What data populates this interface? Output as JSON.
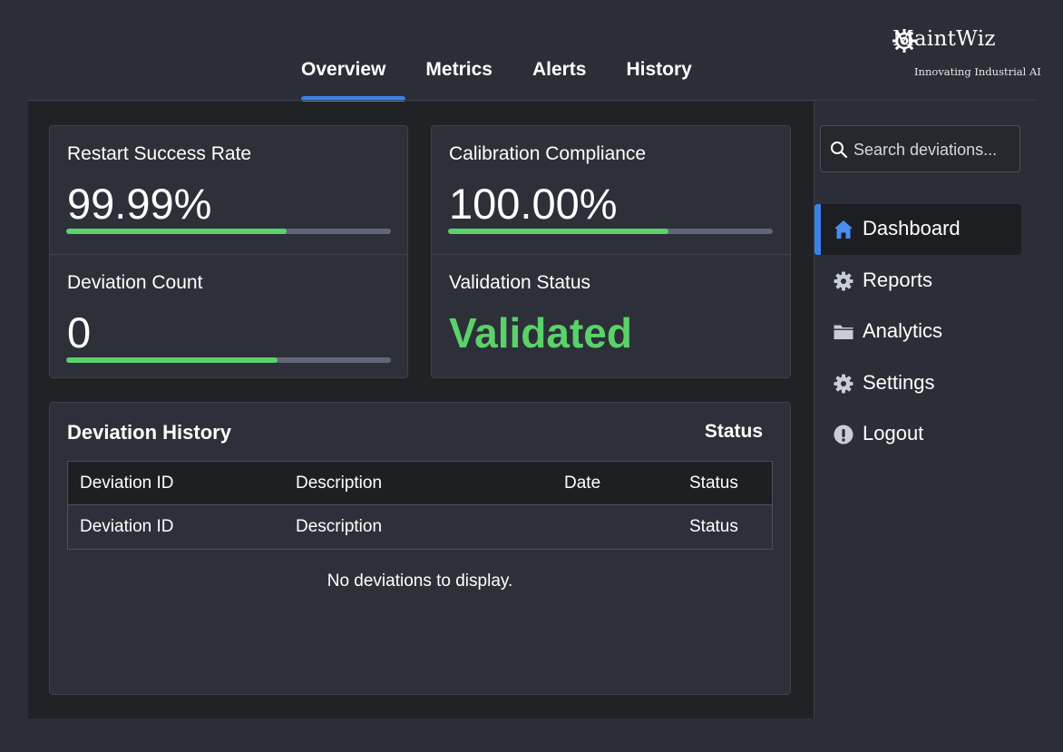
{
  "brand": {
    "name": "MaintWiz",
    "tagline": "Innovating Industrial AI"
  },
  "tabs": [
    {
      "label": "Overview",
      "active": true
    },
    {
      "label": "Metrics",
      "active": false
    },
    {
      "label": "Alerts",
      "active": false
    },
    {
      "label": "History",
      "active": false
    }
  ],
  "metrics": {
    "restart": {
      "label": "Restart Success Rate",
      "value": "99.99%",
      "progress": 0.68
    },
    "calibration": {
      "label": "Calibration Compliance",
      "value": "100.00%",
      "progress": 0.68
    },
    "deviation": {
      "label": "Deviation Count",
      "value": "0",
      "progress": 0.65
    },
    "validation": {
      "label": "Validation Status",
      "value": "Validated"
    }
  },
  "history": {
    "title": "Deviation History",
    "status_label": "Status",
    "columns": [
      "Deviation ID",
      "Description",
      "Date",
      "Status"
    ],
    "rows": [
      [
        "Deviation ID",
        "Description",
        "",
        "Status"
      ]
    ],
    "empty_message": "No deviations to display."
  },
  "search": {
    "placeholder": "Search deviations..."
  },
  "nav": [
    {
      "label": "Dashboard",
      "icon": "home-icon",
      "active": true
    },
    {
      "label": "Reports",
      "icon": "gear-icon",
      "active": false
    },
    {
      "label": "Analytics",
      "icon": "folder-icon",
      "active": false
    },
    {
      "label": "Settings",
      "icon": "gear-icon",
      "active": false
    },
    {
      "label": "Logout",
      "icon": "info-icon",
      "active": false
    }
  ],
  "colors": {
    "accent": "#3b82e8",
    "success": "#5bd16a",
    "background": "#2b2e36",
    "panel": "#202226",
    "card": "#2d3038"
  }
}
